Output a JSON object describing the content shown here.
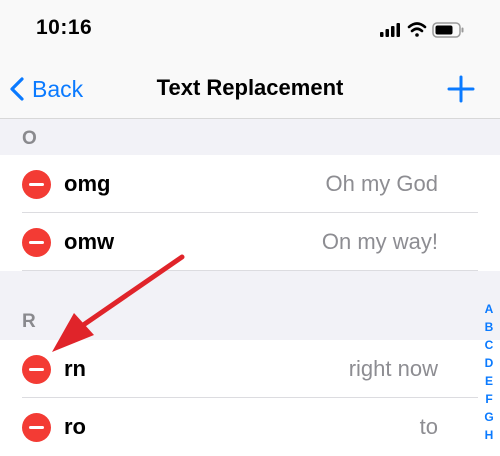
{
  "status_bar": {
    "time": "10:16"
  },
  "nav": {
    "back_label": "Back",
    "title": "Text Replacement"
  },
  "sections": [
    {
      "letter": "O",
      "rows": [
        {
          "shortcut": "omg",
          "phrase": "Oh my God"
        },
        {
          "shortcut": "omw",
          "phrase": "On my way!"
        }
      ]
    },
    {
      "letter": "R",
      "rows": [
        {
          "shortcut": "rn",
          "phrase": "right now"
        },
        {
          "shortcut": "ro",
          "phrase": "to"
        }
      ]
    }
  ],
  "index": [
    "A",
    "B",
    "C",
    "D",
    "E",
    "F",
    "G",
    "H"
  ],
  "colors": {
    "accent": "#0a7aff",
    "delete": "#f33b34",
    "annotation_arrow": "#e0242a"
  },
  "icons": [
    "signal-icon",
    "wifi-icon",
    "battery-icon",
    "chevron-left-icon",
    "plus-icon",
    "minus-circle-icon",
    "red-arrow-annotation"
  ]
}
